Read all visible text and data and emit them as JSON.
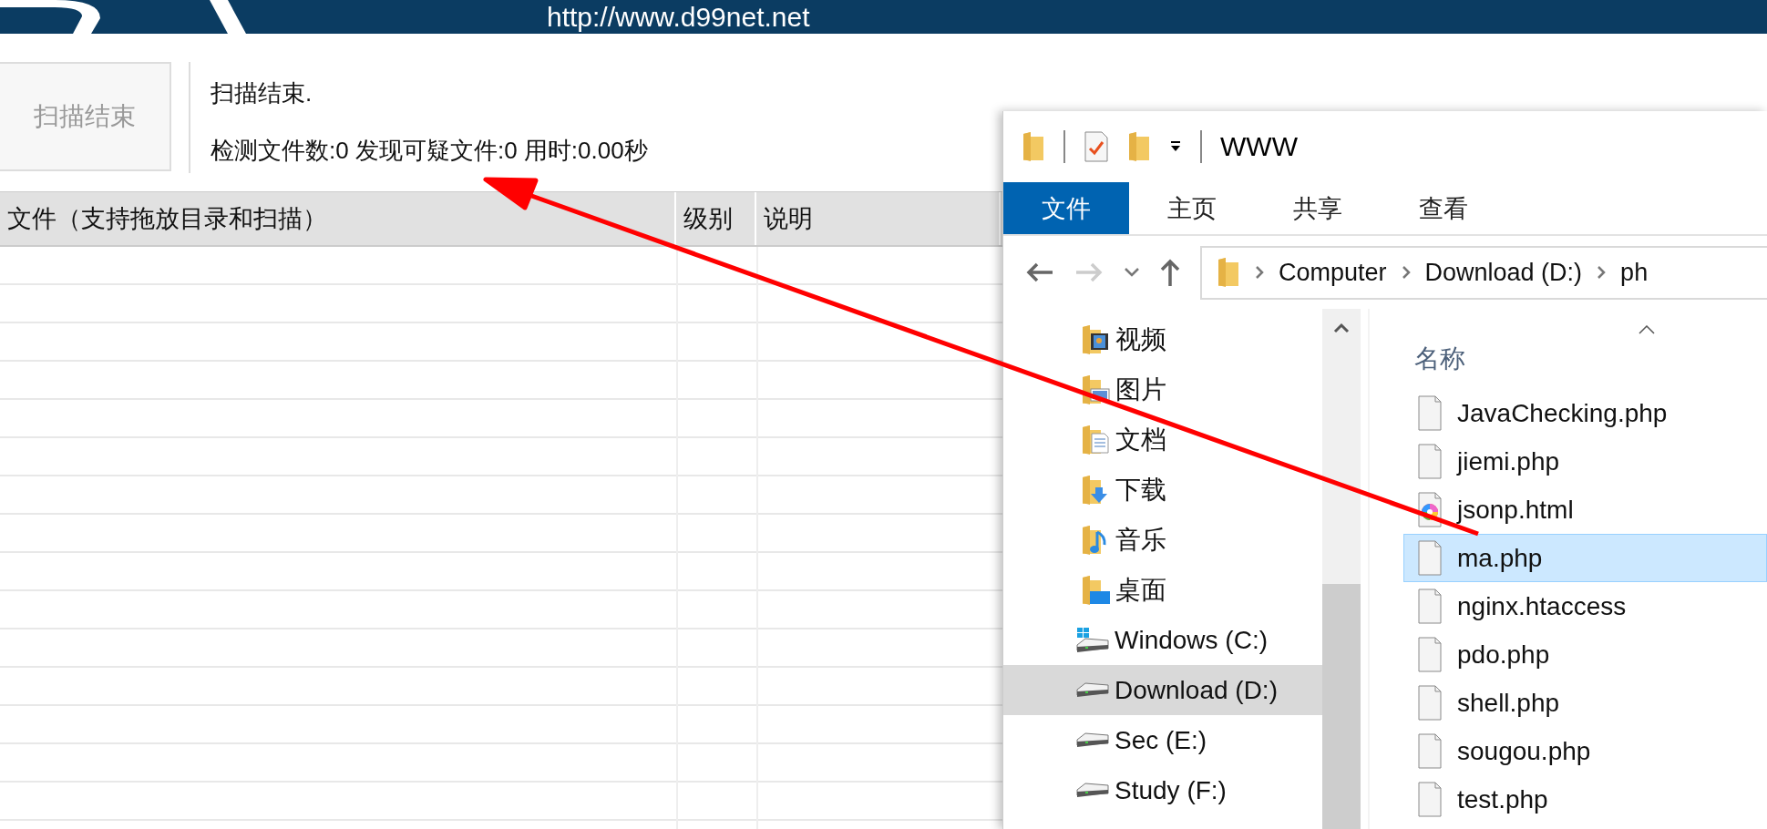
{
  "banner": {
    "url": "http://www.d99net.net"
  },
  "scan_button": {
    "label": "扫描结束",
    "disabled": true
  },
  "status": {
    "title": "扫描结束.",
    "stats": "检测文件数:0 发现可疑文件:0 用时:0.00秒"
  },
  "table": {
    "columns": [
      "文件（支持拖放目录和扫描）",
      "级别",
      "说明"
    ]
  },
  "explorer": {
    "title": "WWW",
    "ribbon_tabs": [
      {
        "label": "文件",
        "selected": true
      },
      {
        "label": "主页",
        "selected": false
      },
      {
        "label": "共享",
        "selected": false
      },
      {
        "label": "查看",
        "selected": false
      }
    ],
    "address": [
      "Computer",
      "Download (D:)",
      "ph"
    ],
    "nav_items": [
      {
        "label": "视频",
        "kind": "videos",
        "selected": false
      },
      {
        "label": "图片",
        "kind": "pictures",
        "selected": false
      },
      {
        "label": "文档",
        "kind": "documents",
        "selected": false
      },
      {
        "label": "下载",
        "kind": "downloads",
        "selected": false
      },
      {
        "label": "音乐",
        "kind": "music",
        "selected": false
      },
      {
        "label": "桌面",
        "kind": "desktop",
        "selected": false
      },
      {
        "label": "Windows (C:)",
        "kind": "system-drive",
        "selected": false
      },
      {
        "label": "Download (D:)",
        "kind": "drive",
        "selected": true
      },
      {
        "label": "Sec (E:)",
        "kind": "drive",
        "selected": false
      },
      {
        "label": "Study (F:)",
        "kind": "drive",
        "selected": false
      }
    ],
    "name_column": "名称",
    "files": [
      {
        "name": "JavaChecking.php",
        "kind": "file",
        "selected": false
      },
      {
        "name": "jiemi.php",
        "kind": "file",
        "selected": false
      },
      {
        "name": "jsonp.html",
        "kind": "html",
        "selected": false
      },
      {
        "name": "ma.php",
        "kind": "file",
        "selected": true
      },
      {
        "name": "nginx.htaccess",
        "kind": "file",
        "selected": false
      },
      {
        "name": "pdo.php",
        "kind": "file",
        "selected": false
      },
      {
        "name": "shell.php",
        "kind": "file",
        "selected": false
      },
      {
        "name": "sougou.php",
        "kind": "file",
        "selected": false
      },
      {
        "name": "test.php",
        "kind": "file",
        "selected": false
      }
    ]
  }
}
